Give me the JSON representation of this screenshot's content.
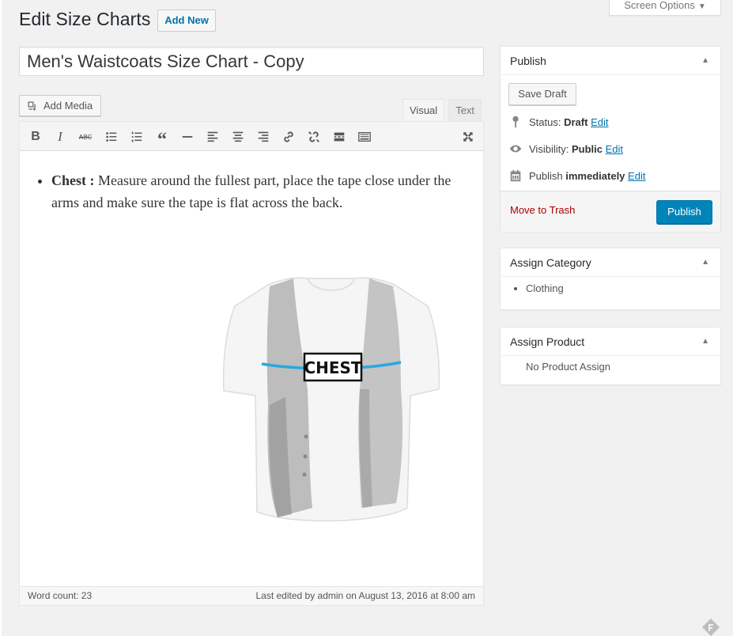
{
  "header": {
    "screen_options_label": "Screen Options",
    "page_title": "Edit Size Charts",
    "add_new_label": "Add New"
  },
  "post": {
    "title_value": "Men's Waistcoats Size Chart - Copy"
  },
  "editor": {
    "add_media_label": "Add Media",
    "tabs": [
      {
        "label": "Visual",
        "active": true
      },
      {
        "label": "Text",
        "active": false
      }
    ],
    "toolbar_icons": [
      "bold-icon",
      "italic-icon",
      "strikethrough-icon",
      "bulleted-list-icon",
      "numbered-list-icon",
      "blockquote-icon",
      "horizontal-line-icon",
      "align-left-icon",
      "align-center-icon",
      "align-right-icon",
      "link-icon",
      "unlink-icon",
      "read-more-icon",
      "toolbar-toggle-icon",
      "fullscreen-icon"
    ],
    "content": {
      "bullet_term": "Chest :",
      "bullet_text": " Measure around the fullest part, place the tape close under the arms and make sure the tape is flat across the back.",
      "image_label": "CHEST",
      "tape_color": "#29a8e0"
    },
    "status": {
      "word_count": "Word count: 23",
      "last_edited": "Last edited by admin on August 13, 2016 at 8:00 am"
    }
  },
  "publish_box": {
    "title": "Publish",
    "save_draft_label": "Save Draft",
    "status_label": "Status:",
    "status_value": "Draft",
    "visibility_label": "Visibility:",
    "visibility_value": "Public",
    "publish_label": "Publish",
    "publish_value": "immediately",
    "edit_label": "Edit",
    "trash_label": "Move to Trash",
    "publish_button_label": "Publish",
    "accent_color": "#0085ba"
  },
  "category_box": {
    "title": "Assign Category",
    "items": [
      "Clothing"
    ]
  },
  "product_box": {
    "title": "Assign Product",
    "empty_text": "No Product Assign"
  }
}
